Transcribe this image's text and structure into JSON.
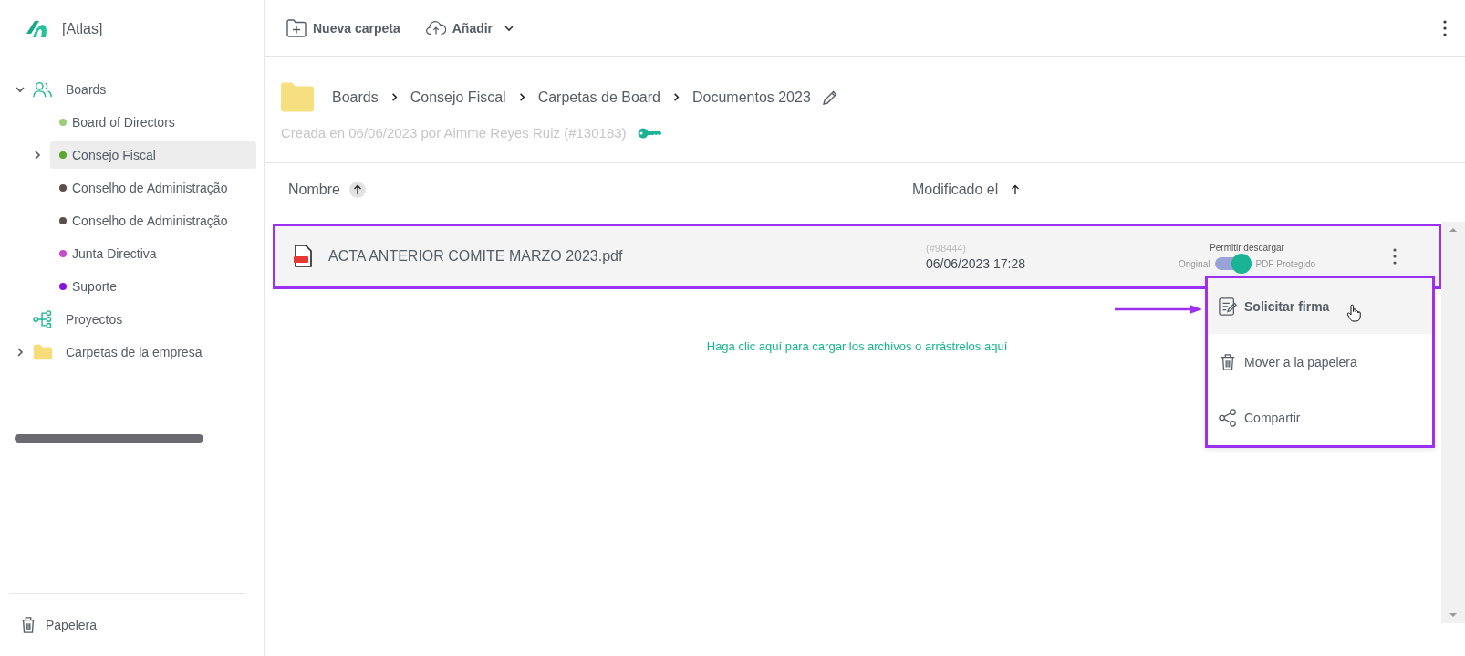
{
  "app": {
    "name": "[Atlas]"
  },
  "sidebar": {
    "tree": [
      {
        "label": "Boards",
        "kind": "group",
        "expanded": true,
        "children": [
          {
            "label": "Board of Directors",
            "color": "#9ccc7a",
            "selected": false
          },
          {
            "label": "Consejo Fiscal",
            "color": "#5aa832",
            "selected": true,
            "expanded": false
          },
          {
            "label": "Conselho de Administração",
            "color": "#5d4e4e",
            "selected": false
          },
          {
            "label": "Conselho de Administração",
            "color": "#5d4e4e",
            "selected": false
          },
          {
            "label": "Junta Directiva",
            "color": "#c64ad0",
            "selected": false
          },
          {
            "label": "Suporte",
            "color": "#8a10e0",
            "selected": false
          }
        ]
      },
      {
        "label": "Proyectos",
        "kind": "project"
      },
      {
        "label": "Carpetas de la empresa",
        "kind": "folder",
        "expanded": false
      }
    ],
    "trash": "Papelera"
  },
  "toolbar": {
    "buttons": [
      {
        "label": "Nueva carpeta",
        "kind": "new-folder"
      },
      {
        "label": "Añadir",
        "kind": "upload"
      }
    ]
  },
  "breadcrumb": [
    "Boards",
    "Consejo Fiscal",
    "Carpetas de Board",
    "Documentos 2023"
  ],
  "created": "Creada en 06/06/2023 por Aimme Reyes Ruiz (#130183)",
  "table": {
    "columns": [
      {
        "label": "Nombre",
        "sorted": true
      },
      {
        "label": "Modificado el",
        "sorted": false
      }
    ],
    "rows": [
      {
        "name": "ACTA ANTERIOR COMITE MARZO 2023.pdf",
        "id": "(#98444)",
        "modified": "06/06/2023 17:28",
        "download_label": "Permitir descargar",
        "off_label": "Original",
        "on_label": "PDF Protegido",
        "on": true,
        "highlighted": true
      }
    ]
  },
  "upload_hint": "Haga clic aquí para cargar los archivos o arrástrelos aquí",
  "context_menu": {
    "highlighted": true,
    "items": [
      {
        "label": "Solicitar firma",
        "kind": "sign",
        "selected": true
      },
      {
        "label": "Mover a la papelera",
        "kind": "trash",
        "selected": false
      },
      {
        "label": "Compartir",
        "kind": "share",
        "selected": false
      }
    ]
  }
}
